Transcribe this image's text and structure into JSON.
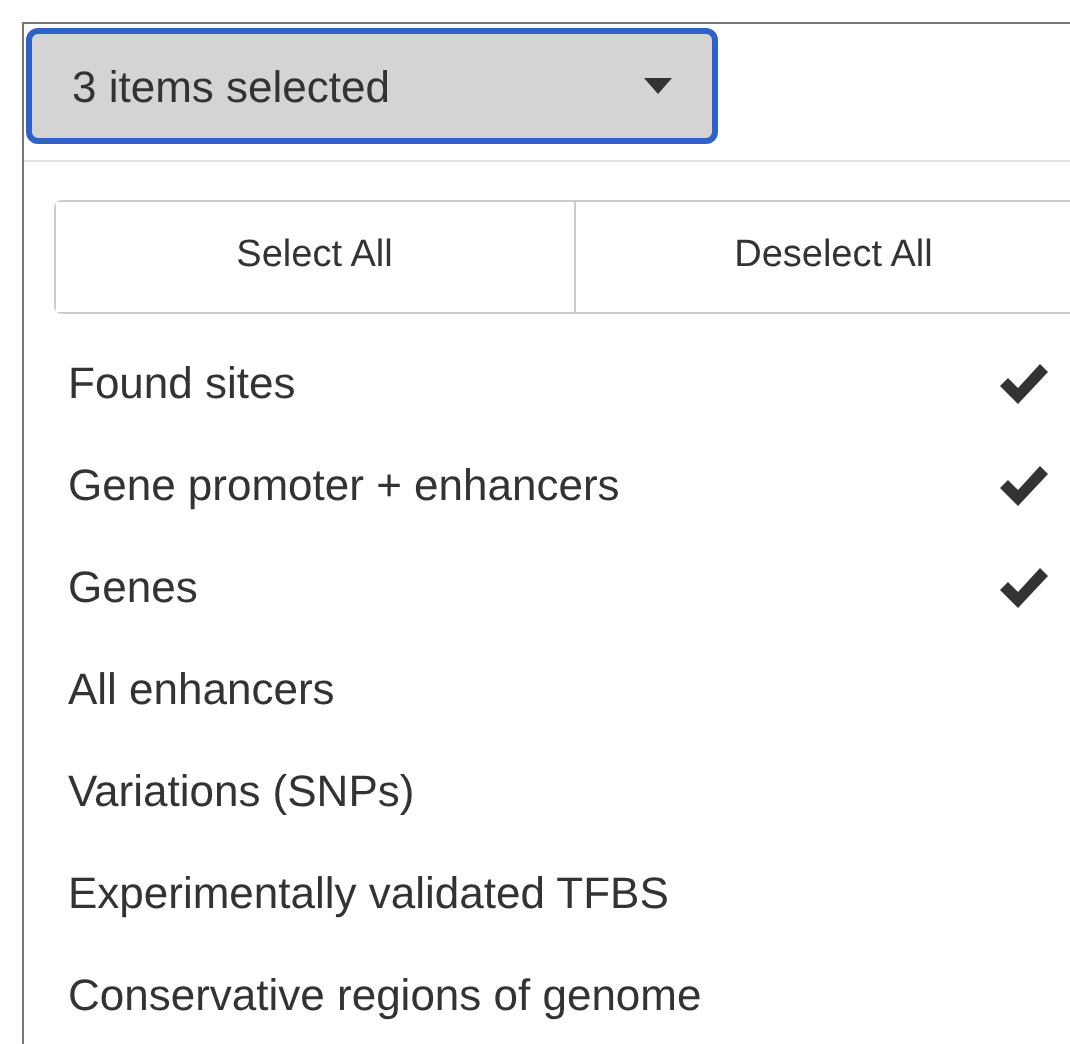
{
  "dropdown": {
    "label": "3 items selected",
    "expanded": true
  },
  "actions": [
    "Select All",
    "Deselect All"
  ],
  "options": [
    {
      "label": "Found sites",
      "checked": true
    },
    {
      "label": "Gene promoter + enhancers",
      "checked": true
    },
    {
      "label": "Genes",
      "checked": true
    },
    {
      "label": "All enhancers",
      "checked": false
    },
    {
      "label": "Variations (SNPs)",
      "checked": false
    },
    {
      "label": "Experimentally validated TFBS",
      "checked": false
    },
    {
      "label": "Conservative regions of genome",
      "checked": false
    }
  ]
}
